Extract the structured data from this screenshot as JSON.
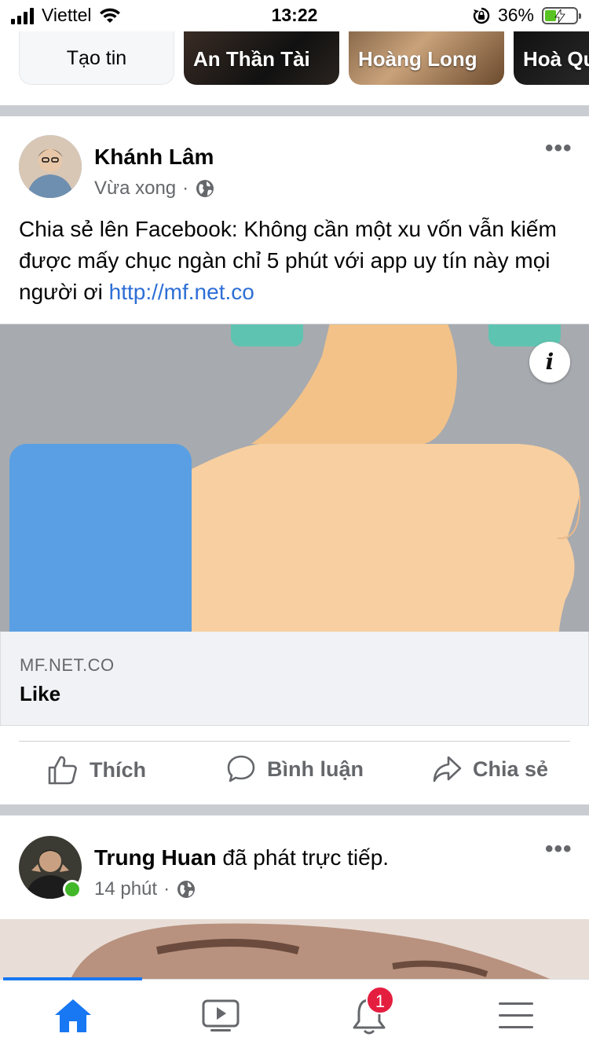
{
  "status_bar": {
    "carrier": "Viettel",
    "time": "13:22",
    "battery": "36%",
    "battery_level": 0.36,
    "icons": [
      "cellular-signal-icon",
      "wifi-icon",
      "rotation-lock-icon",
      "battery-charging-icon"
    ]
  },
  "stories": {
    "create_label": "Tạo tin",
    "items": [
      {
        "name": "An Thần Tài"
      },
      {
        "name": "Hoàng Long"
      },
      {
        "name": "Hoà Qu"
      }
    ]
  },
  "post1": {
    "author": "Khánh Lâm",
    "time": "Vừa xong",
    "separator": "·",
    "text": "Chia sẻ lên Facebook: Không cần một xu vốn vẫn kiếm được mấy chục ngàn chỉ 5 phút với app uy tín này mọi người ơi",
    "link_text": "http://mf.net.co",
    "link_domain": "MF.NET.CO",
    "link_title": "Like",
    "info_glyph": "i"
  },
  "actions": {
    "like": "Thích",
    "comment": "Bình luận",
    "share": "Chia sẻ"
  },
  "post2": {
    "author": "Trung Huan",
    "action_text": " đã phát trực tiếp.",
    "time": "14 phút",
    "separator": "·"
  },
  "bottom_nav": {
    "items": [
      "home-icon",
      "watch-icon",
      "notifications-icon",
      "menu-icon"
    ],
    "notification_count": "1",
    "active": "home"
  },
  "colors": {
    "accent": "#1877f2",
    "link": "#2d6ed6",
    "online": "#42b72a",
    "badge": "#e41e3f",
    "thumb_skin": "#f6cb9c",
    "cuff_blue": "#5a9fe3",
    "teal": "#5ec4b1"
  }
}
